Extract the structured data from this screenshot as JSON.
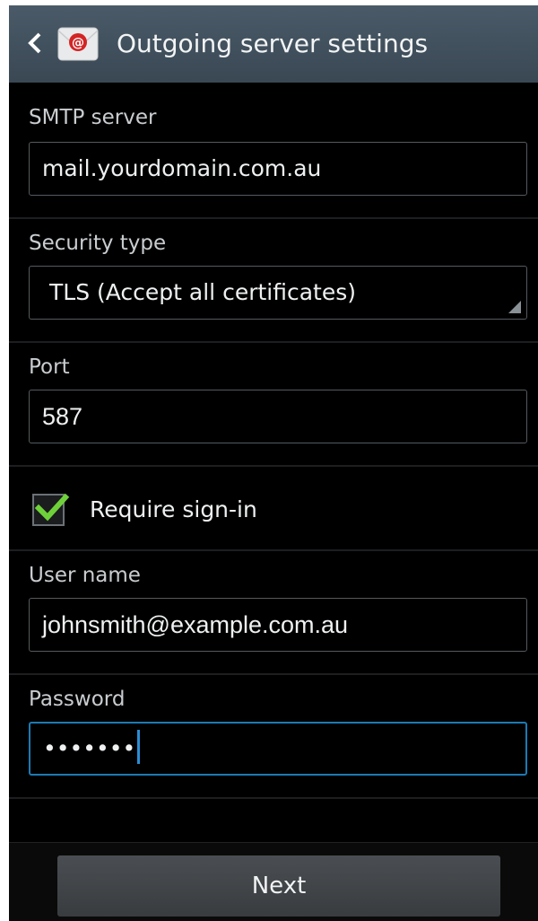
{
  "header": {
    "title": "Outgoing server settings",
    "back_icon": "chevron-left-icon",
    "app_icon": "email-app-icon"
  },
  "smtp": {
    "label": "SMTP server",
    "value": "mail.yourdomain.com.au"
  },
  "security": {
    "label": "Security type",
    "value": "TLS (Accept all certificates)"
  },
  "port": {
    "label": "Port",
    "value": "587"
  },
  "require_signin": {
    "label": "Require sign-in",
    "checked": true
  },
  "username": {
    "label": "User name",
    "value": "johnsmith@example.com.au"
  },
  "password": {
    "label": "Password",
    "masked": "•••••••"
  },
  "footer": {
    "next_label": "Next"
  },
  "colors": {
    "actionbar": "#3f4d59",
    "background": "#000000",
    "focus": "#1c7ab4",
    "check": "#6fd13a"
  }
}
